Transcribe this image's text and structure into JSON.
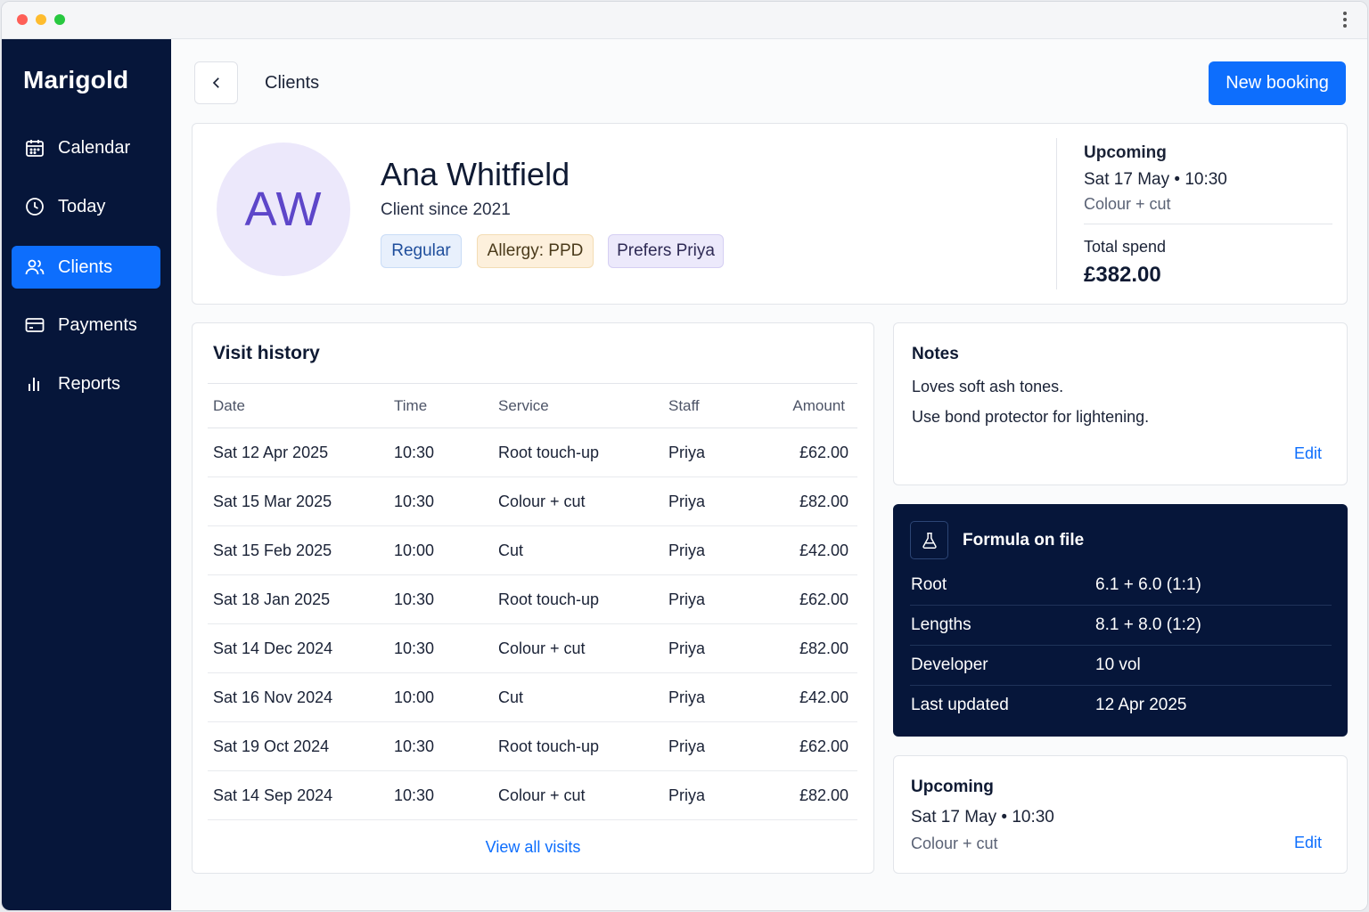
{
  "brand": "Marigold",
  "nav": [
    {
      "label": "Calendar",
      "icon": "calendar-icon"
    },
    {
      "label": "Today",
      "icon": "clock-icon"
    },
    {
      "label": "Clients",
      "icon": "users-icon",
      "active": true
    },
    {
      "label": "Payments",
      "icon": "card-icon"
    },
    {
      "label": "Reports",
      "icon": "bar-chart-icon"
    }
  ],
  "header": {
    "breadcrumb": "Clients",
    "new_booking_label": "New booking"
  },
  "client": {
    "initials": "AW",
    "name": "Ana Whitfield",
    "since": "Client since 2021",
    "tags": [
      "Regular",
      "Allergy: PPD",
      "Prefers Priya"
    ],
    "upcoming_label": "Upcoming",
    "upcoming_date": "Sat 17 May • 10:30",
    "upcoming_service": "Colour + cut",
    "spend_label": "Total spend",
    "spend_value": "£382.00"
  },
  "visits": {
    "title": "Visit history",
    "columns": [
      "Date",
      "Time",
      "Service",
      "Staff",
      "Amount"
    ],
    "rows": [
      [
        "Sat 12 Apr 2025",
        "10:30",
        "Root touch-up",
        "Priya",
        "£62.00"
      ],
      [
        "Sat 15 Mar 2025",
        "10:30",
        "Colour + cut",
        "Priya",
        "£82.00"
      ],
      [
        "Sat 15 Feb 2025",
        "10:00",
        "Cut",
        "Priya",
        "£42.00"
      ],
      [
        "Sat 18 Jan 2025",
        "10:30",
        "Root touch-up",
        "Priya",
        "£62.00"
      ],
      [
        "Sat 14 Dec 2024",
        "10:30",
        "Colour + cut",
        "Priya",
        "£82.00"
      ],
      [
        "Sat 16 Nov 2024",
        "10:00",
        "Cut",
        "Priya",
        "£42.00"
      ],
      [
        "Sat 19 Oct 2024",
        "10:30",
        "Root touch-up",
        "Priya",
        "£62.00"
      ],
      [
        "Sat 14 Sep 2024",
        "10:30",
        "Colour + cut",
        "Priya",
        "£82.00"
      ]
    ],
    "view_all": "View all visits"
  },
  "notes": {
    "title": "Notes",
    "lines": [
      "Loves soft ash tones.",
      "Use bond protector for lightening."
    ],
    "edit": "Edit"
  },
  "formula": {
    "title": "Formula on file",
    "rows": [
      {
        "key": "Root",
        "value": "6.1 + 6.0 (1:1)"
      },
      {
        "key": "Lengths",
        "value": "8.1 + 8.0 (1:2)"
      },
      {
        "key": "Developer",
        "value": "10 vol"
      },
      {
        "key": "Last updated",
        "value": "12 Apr 2025"
      }
    ]
  },
  "upcoming": {
    "label": "Upcoming",
    "date": "Sat 17 May • 10:30",
    "service": "Colour + cut",
    "edit": "Edit"
  },
  "colors": {
    "sidebar": "#06163a",
    "accent": "#0d6efd",
    "avatar_bg": "#ece8fb",
    "avatar_text": "#5d46c9"
  }
}
